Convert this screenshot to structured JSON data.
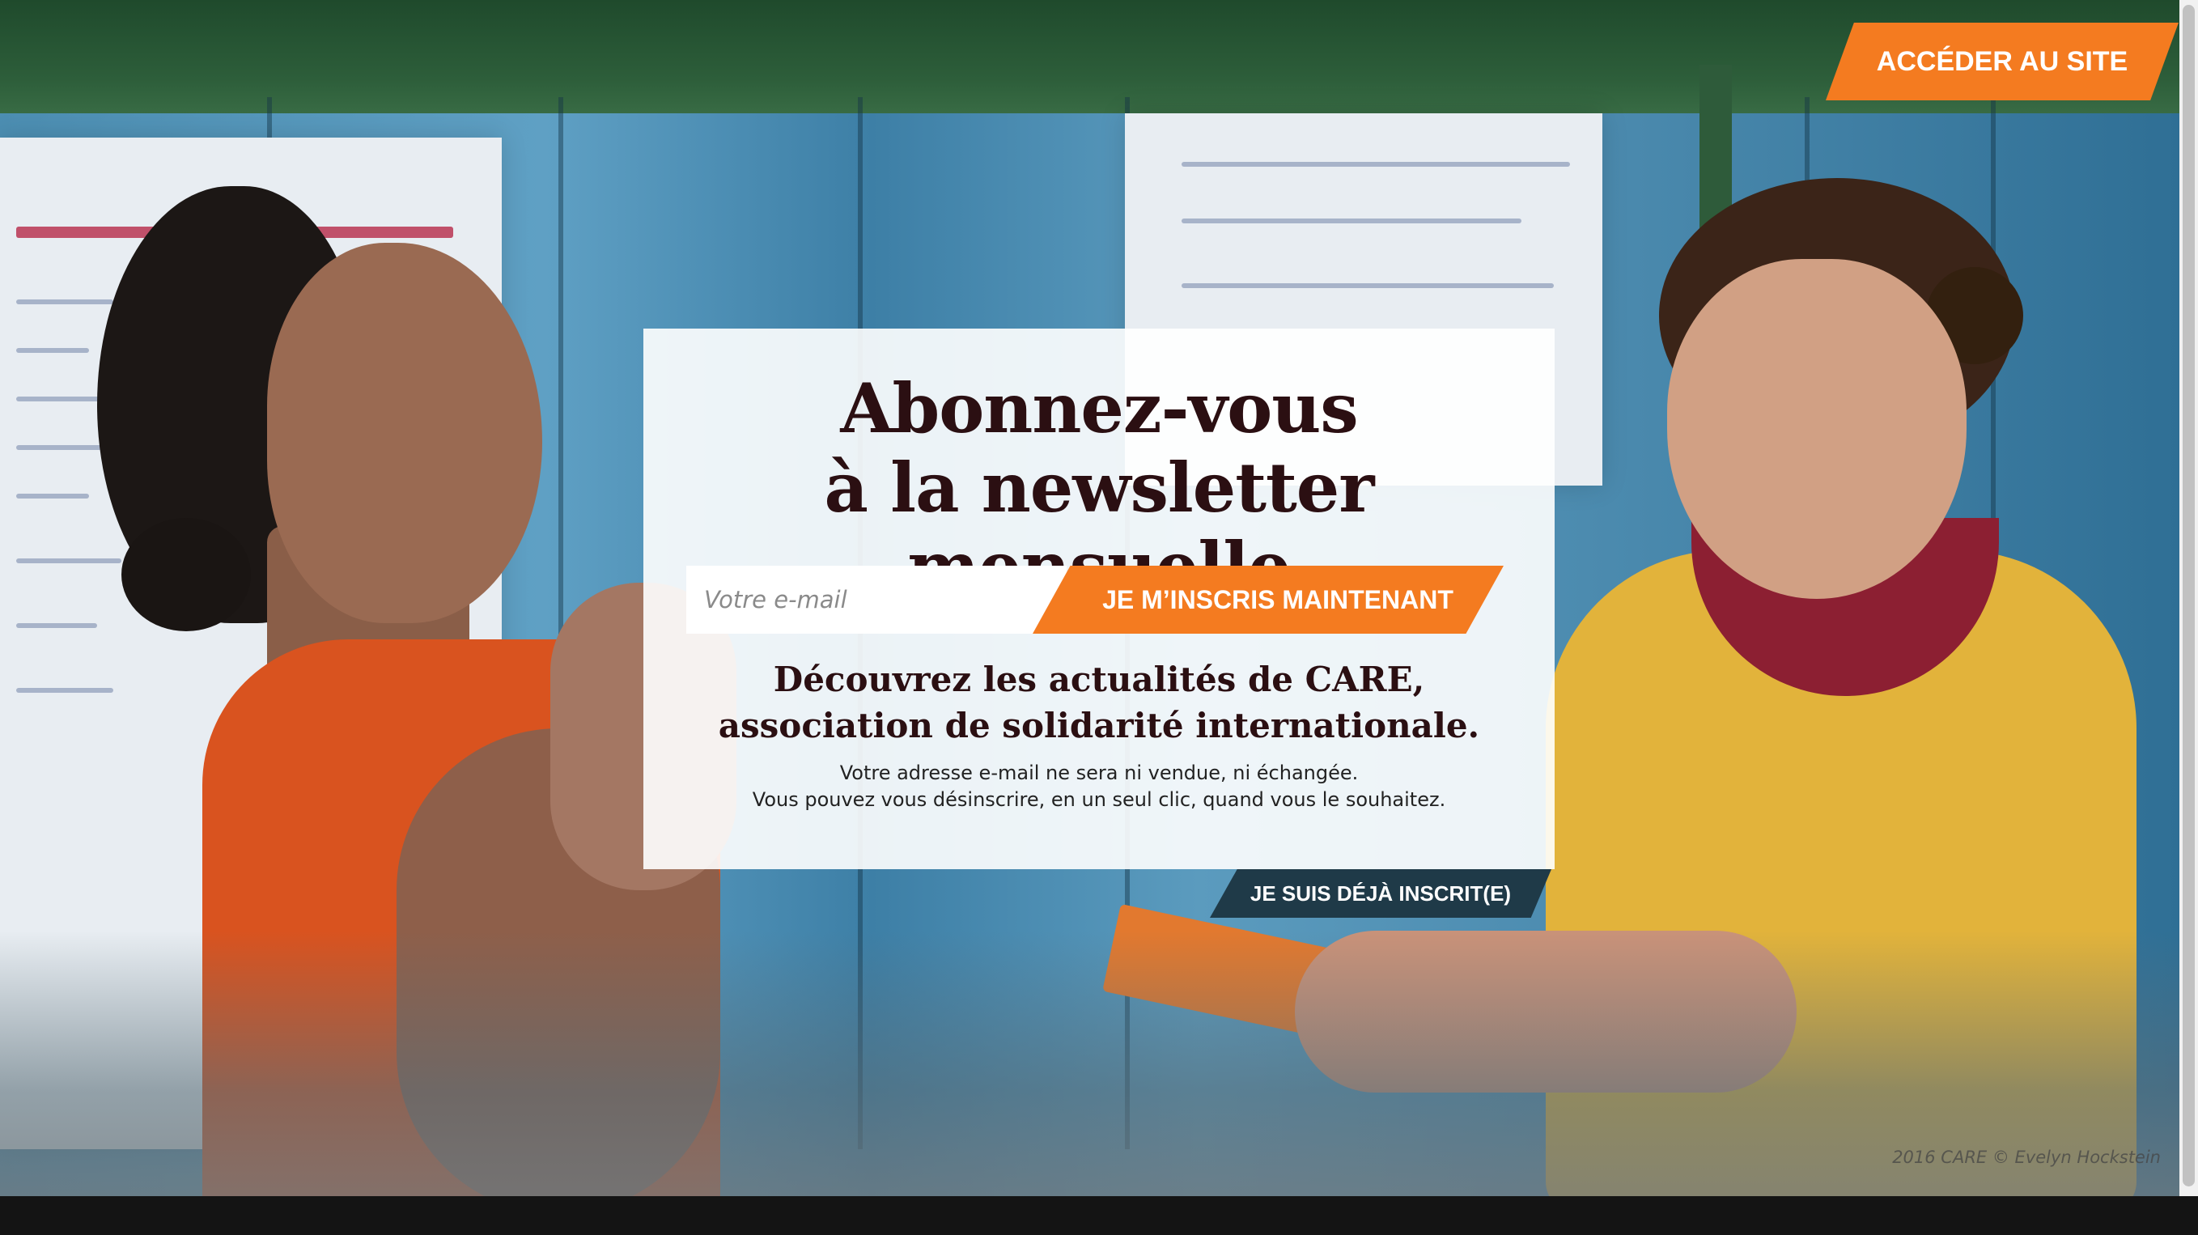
{
  "header": {
    "site_button_label": "ACCÉDER AU SITE"
  },
  "newsletter": {
    "title_line1": "Abonnez-vous",
    "title_line2": "à la newsletter mensuelle",
    "email_placeholder": "Votre e-mail",
    "email_value": "",
    "submit_label": "JE M’INSCRIS MAINTENANT",
    "subtitle_line1": "Découvrez les actualités de CARE,",
    "subtitle_line2": "association de solidarité internationale.",
    "note_line1": "Votre adresse e-mail ne sera ni vendue, ni échangée.",
    "note_line2": "Vous pouvez vous désinscrire, en un seul clic, quand vous le souhaitez.",
    "already_subscribed_label": "JE SUIS DÉJÀ INSCRIT(E)"
  },
  "photo_credit": "2016 CARE © Evelyn Hockstein",
  "colors": {
    "accent": "#f47b20",
    "dark_button": "#1f3a48",
    "title": "#2b0f12"
  }
}
